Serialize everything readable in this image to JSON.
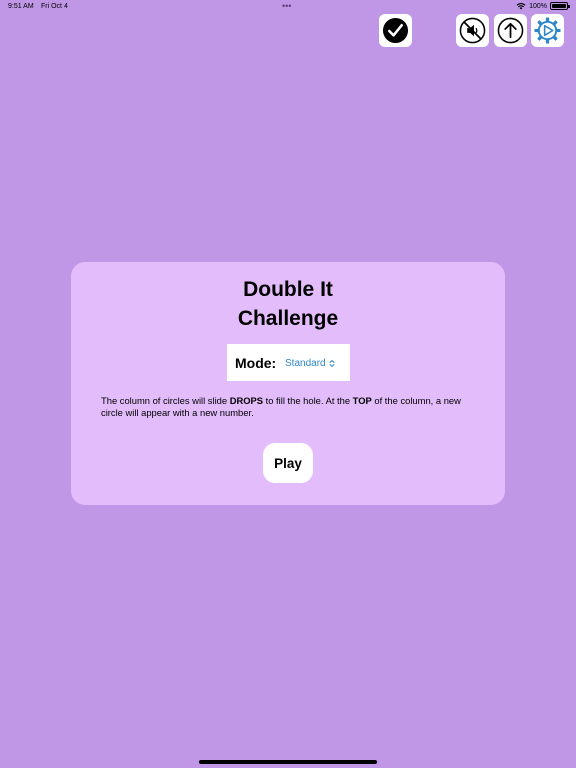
{
  "status_bar": {
    "time": "9:51 AM",
    "date": "Fri Oct 4",
    "dots": "•••",
    "battery": "100%"
  },
  "toolbar": {
    "check_icon": "checkmark-circle-icon",
    "mute_icon": "speaker-muted-icon",
    "share_icon": "arrow-up-circle-icon",
    "settings_icon": "gear-play-icon",
    "settings_color": "#2e86c9"
  },
  "card": {
    "title_line1": "Double It",
    "title_line2": "Challenge",
    "mode_label": "Mode:",
    "mode_value": "Standard",
    "description": {
      "part1": "The column of circles will slide ",
      "bold1": "DROPS",
      "part2": " to fill the hole.  At the ",
      "bold2": "TOP",
      "part3": " of the column, a new circle will appear with a new number."
    },
    "play_label": "Play"
  },
  "colors": {
    "background": "#bf97e6",
    "card": "#e3bcfb",
    "accent": "#2e86c9"
  }
}
